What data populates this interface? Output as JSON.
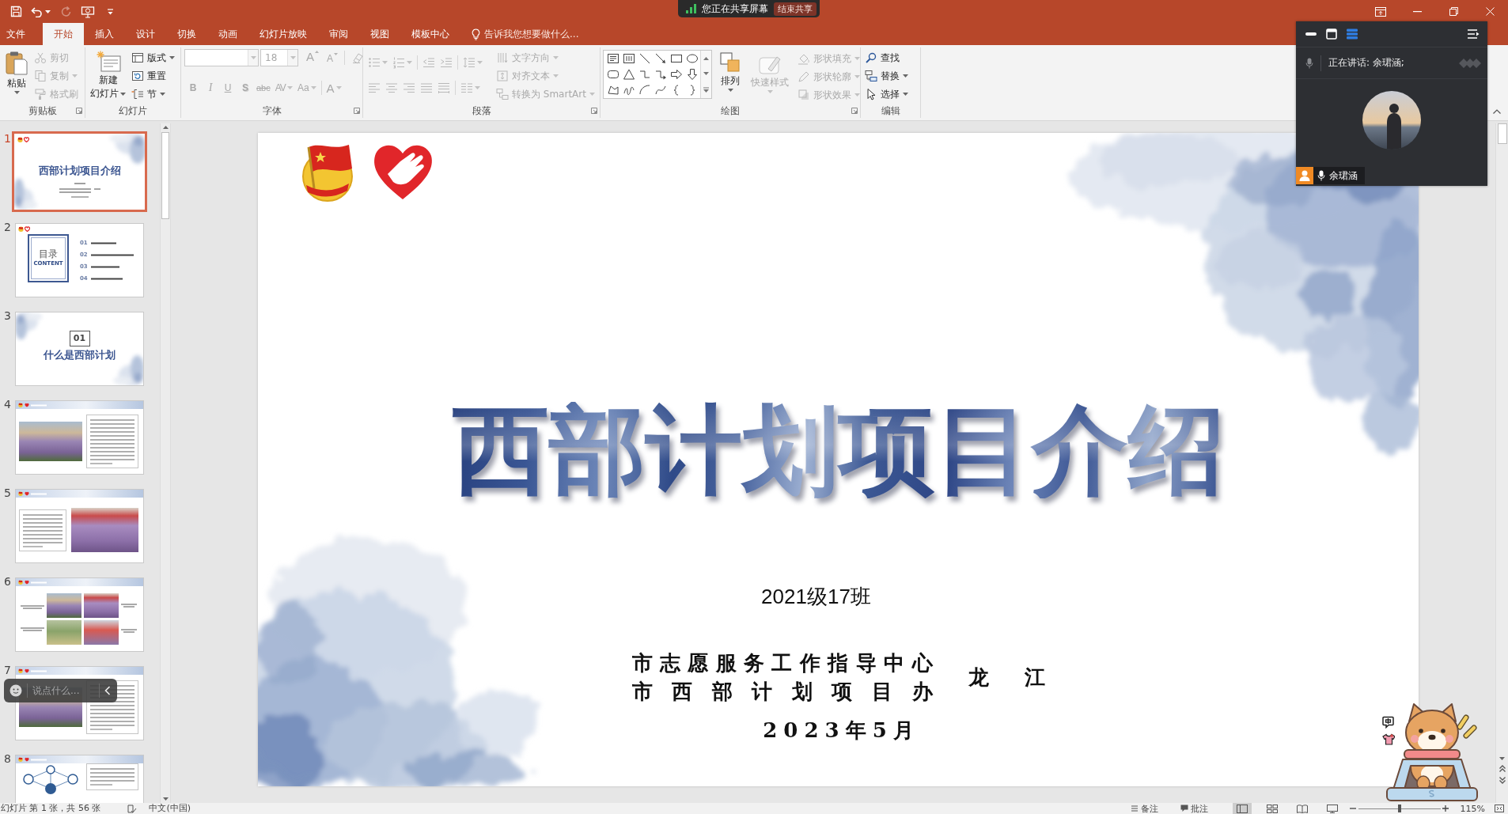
{
  "title_bar": {
    "quick_access": [
      {
        "kind": "save",
        "disabled": false
      },
      {
        "kind": "undo",
        "disabled": false
      },
      {
        "kind": "redo",
        "disabled": true
      },
      {
        "kind": "slideshow",
        "disabled": false
      },
      {
        "kind": "customize",
        "disabled": false
      }
    ]
  },
  "share_banner": {
    "status": "您正在共享屏幕",
    "button": "结束共享"
  },
  "tabs": [
    {
      "label": "文件",
      "selected": false
    },
    {
      "label": "开始",
      "selected": true
    },
    {
      "label": "插入",
      "selected": false
    },
    {
      "label": "设计",
      "selected": false
    },
    {
      "label": "切换",
      "selected": false
    },
    {
      "label": "动画",
      "selected": false
    },
    {
      "label": "幻灯片放映",
      "selected": false
    },
    {
      "label": "审阅",
      "selected": false
    },
    {
      "label": "视图",
      "selected": false
    },
    {
      "label": "模板中心",
      "selected": false
    }
  ],
  "tell_me": {
    "placeholder": "告诉我您想要做什么..."
  },
  "ribbon": [
    {
      "kind": "clipboard",
      "label": "剪贴板",
      "launcher": true,
      "large": {
        "label": "粘贴",
        "disabled": false,
        "dropdown": true
      },
      "tools": [
        {
          "label": "剪切",
          "disabled": true,
          "dropdown": false
        },
        {
          "label": "复制",
          "disabled": true,
          "dropdown": true
        },
        {
          "label": "格式刷",
          "disabled": true,
          "dropdown": false
        }
      ]
    },
    {
      "kind": "slides",
      "label": "幻灯片",
      "launcher": false,
      "large": {
        "label": "新建",
        "label_2": "幻灯片",
        "disabled": false,
        "dropdown": true
      },
      "tools": [
        {
          "label": "版式",
          "disabled": false,
          "dropdown": true
        },
        {
          "label": "重置",
          "disabled": false,
          "dropdown": false
        },
        {
          "label": "节",
          "disabled": false,
          "dropdown": true
        }
      ]
    },
    {
      "kind": "font",
      "label": "字体",
      "launcher": true,
      "disabled": true,
      "font_size": "18",
      "size_buttons": [
        {
          "label": "A",
          "kind": "grow"
        },
        {
          "label": "A",
          "kind": "shrink"
        }
      ],
      "format_buttons": [
        {
          "label": "B",
          "kind": "bold",
          "dropdown": false
        },
        {
          "label": "I",
          "kind": "italic",
          "dropdown": false
        },
        {
          "label": "U",
          "kind": "underline",
          "dropdown": false
        },
        {
          "label": "S",
          "kind": "shadow",
          "dropdown": false
        },
        {
          "label": "abc",
          "kind": "strike",
          "dropdown": false
        },
        {
          "label": "AV",
          "kind": "spacing",
          "dropdown": true
        },
        {
          "label": "Aa",
          "kind": "case",
          "dropdown": true
        },
        {
          "label": "A",
          "kind": "color",
          "dropdown": true
        }
      ]
    },
    {
      "kind": "paragraph",
      "label": "段落",
      "launcher": true,
      "disabled": true,
      "tools": [
        {
          "label": "文字方向",
          "disabled": true,
          "dropdown": true
        },
        {
          "label": "对齐文本",
          "disabled": true,
          "dropdown": true
        },
        {
          "label": "转换为 SmartArt",
          "disabled": true,
          "dropdown": true
        }
      ]
    },
    {
      "kind": "drawing",
      "label": "绘图",
      "launcher": true,
      "large": [
        {
          "label": "排列",
          "disabled": false,
          "dropdown": true
        },
        {
          "label": "快速样式",
          "disabled": true,
          "dropdown": true
        }
      ],
      "tools": [
        {
          "label": "形状填充",
          "disabled": true,
          "dropdown": true
        },
        {
          "label": "形状轮廓",
          "disabled": true,
          "dropdown": true
        },
        {
          "label": "形状效果",
          "disabled": true,
          "dropdown": true
        }
      ]
    },
    {
      "kind": "editing",
      "label": "编辑",
      "launcher": false,
      "tools": [
        {
          "label": "查找",
          "disabled": false,
          "dropdown": false
        },
        {
          "label": "替换",
          "disabled": false,
          "dropdown": true
        },
        {
          "label": "选择",
          "disabled": false,
          "dropdown": true
        }
      ]
    }
  ],
  "thumbnails": [
    {
      "number": "1",
      "selected": true,
      "kind": "title",
      "title": "西部计划项目介绍"
    },
    {
      "number": "2",
      "selected": false,
      "kind": "contents",
      "heading": "目录",
      "subheading": "CONTENT",
      "items": [
        "01",
        "02",
        "03",
        "04"
      ]
    },
    {
      "number": "3",
      "selected": false,
      "kind": "section",
      "section_number": "01",
      "title": "什么是西部计划"
    },
    {
      "number": "4",
      "selected": false,
      "kind": "photo_text"
    },
    {
      "number": "5",
      "selected": false,
      "kind": "text_photo"
    },
    {
      "number": "6",
      "selected": false,
      "kind": "photo_grid"
    },
    {
      "number": "7",
      "selected": false,
      "kind": "photo_text"
    },
    {
      "number": "8",
      "selected": false,
      "kind": "diagram_text"
    }
  ],
  "slide": {
    "title": "西部计划项目介绍",
    "class_name": "2021级17班",
    "organizations": [
      "市志愿服务工作指导中心",
      "市西部计划项目办"
    ],
    "speaker": "龙江",
    "date": "2023年5月"
  },
  "meeting": {
    "speaking": "正在讲话: 余珺涵;",
    "participant": "余珺涵"
  },
  "chat": {
    "placeholder": "说点什么..."
  },
  "status_bar": {
    "slide_info": "幻灯片 第 1 张，共 56 张",
    "language": "中文(中国)",
    "notes": "备注",
    "comments": "批注",
    "views": [
      {
        "kind": "normal",
        "selected": true
      },
      {
        "kind": "sorter",
        "selected": false
      },
      {
        "kind": "reading",
        "selected": false
      },
      {
        "kind": "slideshow",
        "selected": false
      }
    ],
    "zoom_slider": {
      "level": 0.5
    },
    "zoom": "115%"
  }
}
